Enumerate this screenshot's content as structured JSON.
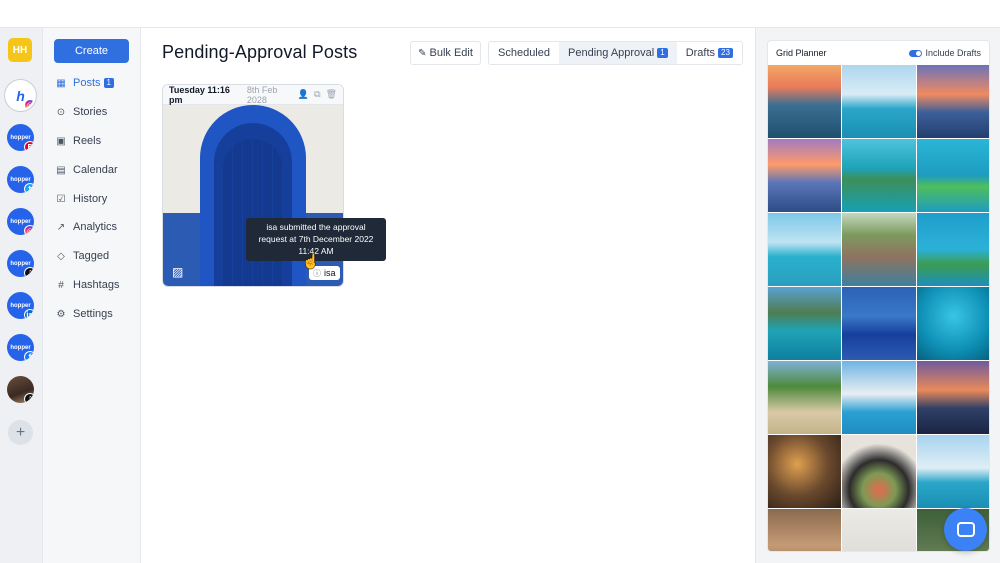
{
  "brand": {
    "initials": "HH"
  },
  "accounts": [
    {
      "name": "instagram-active",
      "label": "h",
      "badge": "ig"
    },
    {
      "name": "pinterest",
      "label": "hopper",
      "badge": "pin"
    },
    {
      "name": "twitter",
      "label": "hopper",
      "badge": "tw"
    },
    {
      "name": "instagram",
      "label": "hopper",
      "badge": "ig"
    },
    {
      "name": "tiktok",
      "label": "hopper",
      "badge": "tt"
    },
    {
      "name": "linkedin",
      "label": "hopper",
      "badge": "in"
    },
    {
      "name": "facebook",
      "label": "hopper",
      "badge": "fb"
    },
    {
      "name": "tiktok-personal",
      "label": "",
      "badge": "tt"
    }
  ],
  "nav": {
    "create_label": "Create",
    "items": [
      {
        "label": "Posts",
        "icon": "grid-icon",
        "count": "1"
      },
      {
        "label": "Stories",
        "icon": "stories-icon"
      },
      {
        "label": "Reels",
        "icon": "reels-icon"
      },
      {
        "label": "Calendar",
        "icon": "calendar-icon"
      },
      {
        "label": "History",
        "icon": "history-icon"
      },
      {
        "label": "Analytics",
        "icon": "analytics-icon"
      },
      {
        "label": "Tagged",
        "icon": "tag-icon"
      },
      {
        "label": "Hashtags",
        "icon": "hashtag-icon"
      },
      {
        "label": "Settings",
        "icon": "gear-icon"
      }
    ]
  },
  "header": {
    "title": "Pending-Approval Posts",
    "bulk_edit_label": "Bulk Edit",
    "tabs": [
      {
        "label": "Scheduled"
      },
      {
        "label": "Pending Approval",
        "count": "1"
      },
      {
        "label": "Drafts",
        "count": "23"
      }
    ]
  },
  "post": {
    "time": "Tuesday 11:16 pm",
    "date": "8th Feb 2028",
    "user": "isa",
    "tooltip_line1": "isa submitted the approval",
    "tooltip_line2": "request at 7th December 2022",
    "tooltip_line3": "11:42 AM"
  },
  "planner": {
    "title": "Grid Planner",
    "toggle_label": "Include Drafts",
    "include_drafts": true
  },
  "colors": {
    "accent": "#2f6fdf",
    "brand_yellow": "#f5c518",
    "tooltip_bg": "#1f2937"
  }
}
